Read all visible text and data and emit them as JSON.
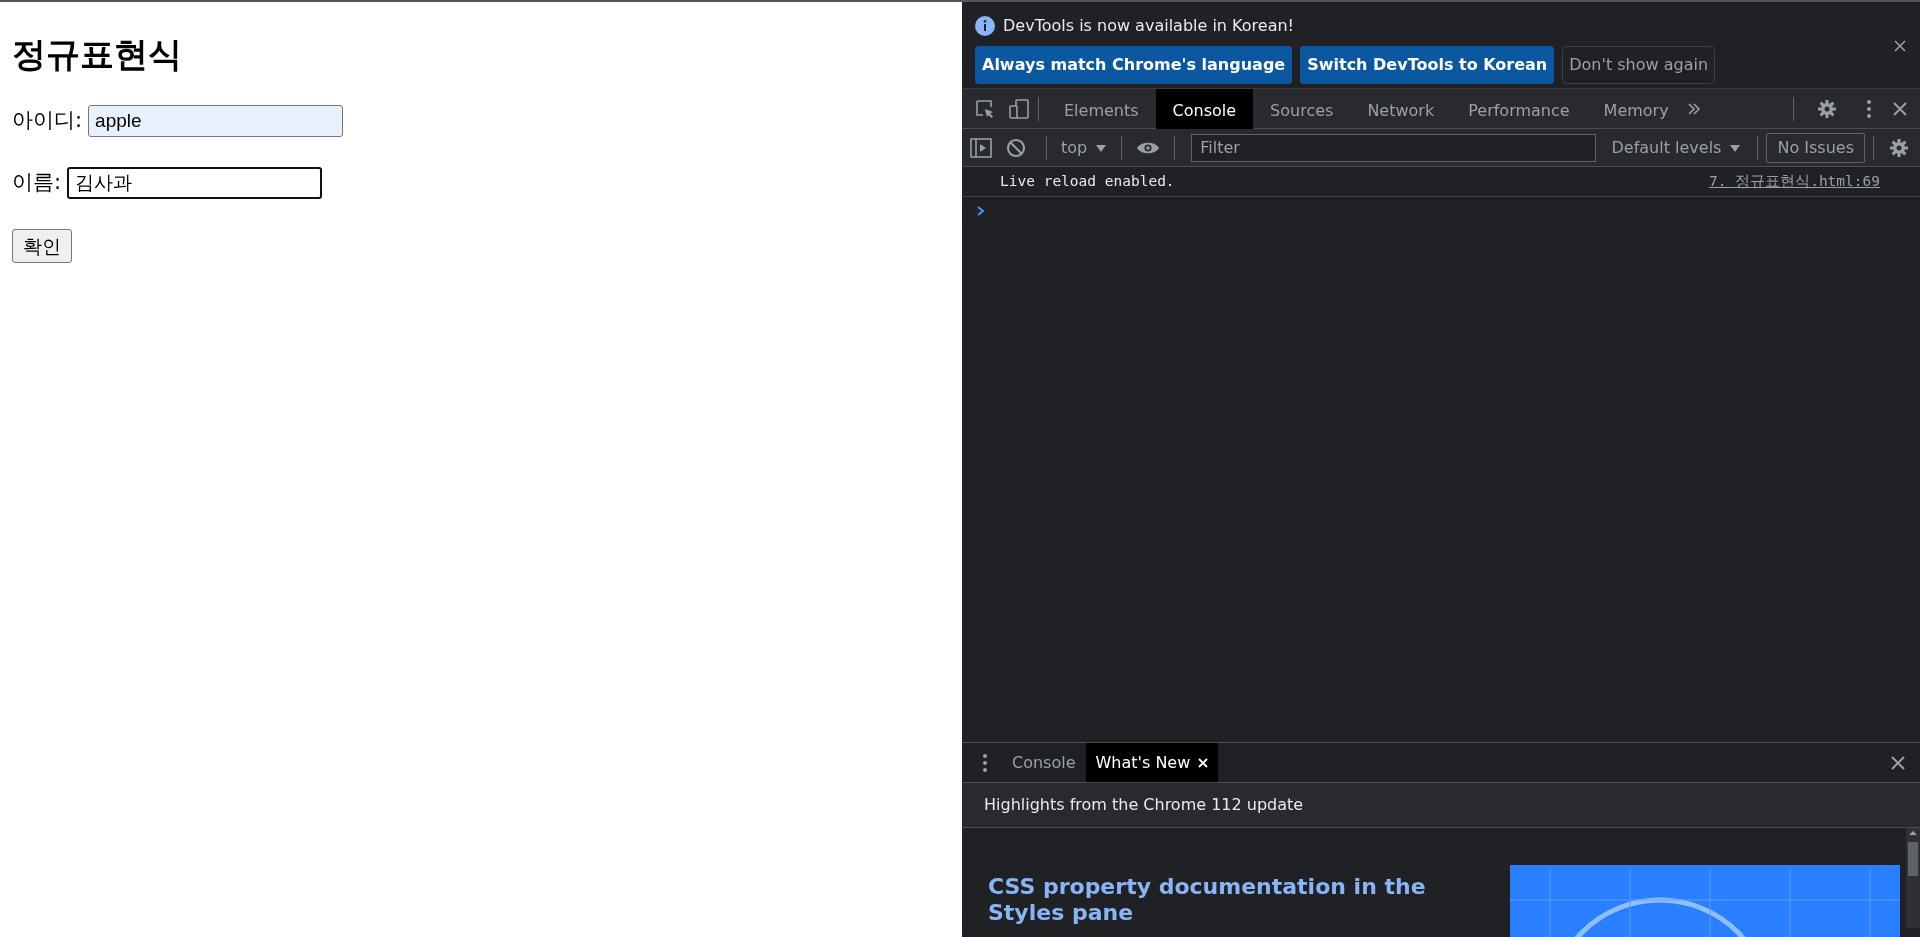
{
  "page": {
    "heading": "정규표현식",
    "fields": [
      {
        "label": "아이디:",
        "value": "apple",
        "autofilled": true,
        "focused": false
      },
      {
        "label": "이름:",
        "value": "김사과",
        "autofilled": false,
        "focused": true
      }
    ],
    "submit": "확인"
  },
  "devtools": {
    "infobar": {
      "message": "DevTools is now available in Korean!",
      "buttons": [
        {
          "label": "Always match Chrome's language",
          "kind": "primary"
        },
        {
          "label": "Switch DevTools to Korean",
          "kind": "primary"
        },
        {
          "label": "Don't show again",
          "kind": "secondary"
        }
      ]
    },
    "tabs": [
      {
        "label": "Elements",
        "selected": false
      },
      {
        "label": "Console",
        "selected": true
      },
      {
        "label": "Sources",
        "selected": false
      },
      {
        "label": "Network",
        "selected": false
      },
      {
        "label": "Performance",
        "selected": false
      },
      {
        "label": "Memory",
        "selected": false
      }
    ],
    "console_toolbar": {
      "context": "top",
      "filter_placeholder": "Filter",
      "levels": "Default levels",
      "issues": "No Issues"
    },
    "messages": [
      {
        "text": "Live reload enabled.",
        "source": "7. 정규표현식.html:69"
      }
    ],
    "drawer": {
      "tabs": [
        {
          "label": "Console",
          "selected": false,
          "closable": false
        },
        {
          "label": "What's New",
          "selected": true,
          "closable": true
        }
      ],
      "banner": "Highlights from the Chrome 112 update",
      "article_title": "CSS property documentation in the Styles pane"
    }
  }
}
